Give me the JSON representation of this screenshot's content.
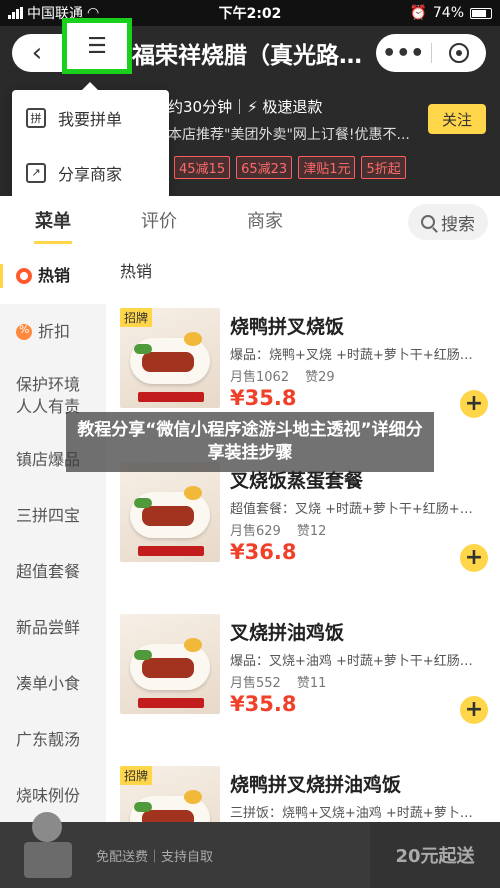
{
  "status_bar": {
    "carrier": "中国联通",
    "time": "下午2:02",
    "battery": "74%"
  },
  "header": {
    "store_name": "福荣祥烧腊（真光路…",
    "delivery_info": "约30分钟｜⚡ 极速退款",
    "notice": "本店推荐\"美团外卖\"网上订餐!优惠不...",
    "follow_label": "关注",
    "promo_tags": [
      "45减15",
      "65减23",
      "津贴1元",
      "5折起"
    ]
  },
  "menu": {
    "items": [
      {
        "label": "我要拼单",
        "icon": "group-order-icon"
      },
      {
        "label": "分享商家",
        "icon": "share-icon"
      }
    ]
  },
  "tabs": {
    "menu": "菜单",
    "reviews": "评价",
    "merchant": "商家",
    "search": "搜索"
  },
  "sidebar": {
    "items": [
      "热销",
      "折扣",
      "保护环境\n人人有责",
      "镇店爆品",
      "三拼四宝",
      "超值套餐",
      "新品尝鲜",
      "凑单小食",
      "广东靓汤",
      "烧味例份"
    ]
  },
  "content": {
    "section_title": "热销",
    "foods": [
      {
        "badge": "招牌",
        "name": "烧鸭拼叉烧饭",
        "desc": "爆品：烧鸭+叉烧 +时蔬+萝卜干+红肠…",
        "monthly_sales": "月售1062",
        "likes": "赞29",
        "price": "¥35.8"
      },
      {
        "badge": "",
        "name": "叉烧饭蒸蛋套餐",
        "desc": "超值套餐：叉烧 +时蔬+萝卜干+红肠+…",
        "monthly_sales": "月售629",
        "likes": "赞12",
        "price": "¥36.8"
      },
      {
        "badge": "",
        "name": "叉烧拼油鸡饭",
        "desc": "爆品：叉烧+油鸡 +时蔬+萝卜干+红肠…",
        "monthly_sales": "月售552",
        "likes": "赞11",
        "price": "¥35.8"
      },
      {
        "badge": "招牌",
        "name": "烧鸭拼叉烧拼油鸡饭",
        "desc": "三拼饭：烧鸭+叉烧+油鸡 +时蔬+萝卜…",
        "monthly_sales": "",
        "likes": "",
        "price": ""
      }
    ]
  },
  "overlay": {
    "text": "教程分享“微信小程序途游斗地主透视”详细分享装挂步骤"
  },
  "cart": {
    "delivery": "免配送费｜支持自取",
    "checkout": "20元起送"
  }
}
